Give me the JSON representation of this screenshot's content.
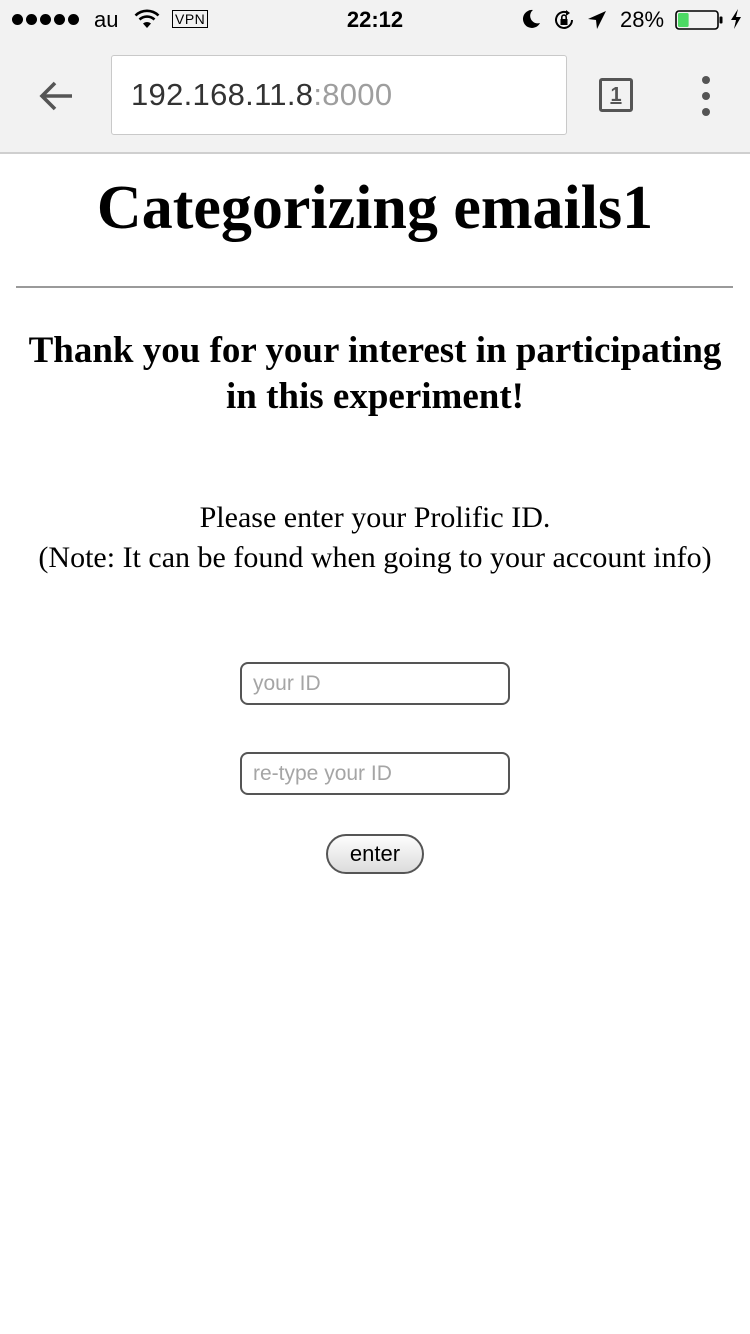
{
  "status_bar": {
    "carrier": "au",
    "vpn_label": "VPN",
    "time": "22:12",
    "battery_percent_label": "28%",
    "battery_level": 0.28,
    "battery_color": "#4cd964",
    "icons": [
      "signal-dots",
      "wifi-icon",
      "moon-icon",
      "lock-rotation-icon",
      "location-icon",
      "battery-icon",
      "charging-icon"
    ]
  },
  "browser": {
    "url_host": "192.168.11.8",
    "url_port": ":8000",
    "tab_count": "1",
    "icons": [
      "back-arrow-icon",
      "tabs-icon",
      "more-vert-icon"
    ]
  },
  "page": {
    "title": "Categorizing emails1",
    "thanks": "Thank you for your interest in participating in this experiment!",
    "instruction_line1": "Please enter your Prolific ID.",
    "instruction_line2": "(Note: It can be found when going to your account info)",
    "id_placeholder": "your ID",
    "retype_placeholder": "re-type your ID",
    "enter_label": "enter"
  }
}
